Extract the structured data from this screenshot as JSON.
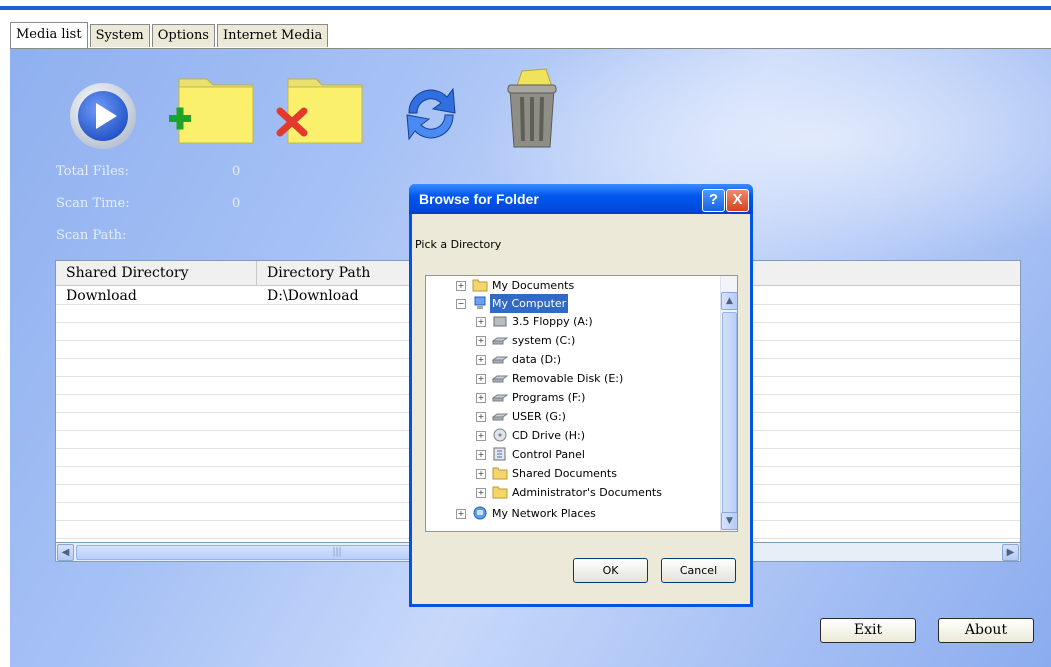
{
  "tabs": [
    "Media list",
    "System",
    "Options",
    "Internet Media"
  ],
  "toolbar": {
    "play": "play-icon",
    "add_folder": "add-folder-icon",
    "remove_folder": "remove-folder-icon",
    "refresh": "refresh-icon",
    "trash": "recycle-bin-icon"
  },
  "info": {
    "total_files_label": "Total Files:",
    "total_files_value": "0",
    "scan_time_label": "Scan Time:",
    "scan_time_value": "0",
    "scan_path_label": "Scan Path:"
  },
  "grid": {
    "columns": [
      "Shared Directory",
      "Directory Path"
    ],
    "rows": [
      {
        "name": "Download",
        "path": "D:\\Download"
      }
    ]
  },
  "buttons": {
    "exit": "Exit",
    "about": "About"
  },
  "dialog": {
    "title": "Browse for Folder",
    "help": "?",
    "close": "X",
    "label": "Pick a Directory",
    "tree": [
      "My Documents",
      "My Computer",
      "3.5 Floppy (A:)",
      "system (C:)",
      "data (D:)",
      "Removable Disk (E:)",
      "Programs (F:)",
      "USER (G:)",
      "CD Drive (H:)",
      "Control Panel",
      "Shared Documents",
      "Administrator's Documents",
      "My Network Places"
    ],
    "ok": "OK",
    "cancel": "Cancel"
  },
  "colors": {
    "titlebar": "#0058ee",
    "selection": "#316ac5",
    "panel": "#a6c1f5"
  }
}
